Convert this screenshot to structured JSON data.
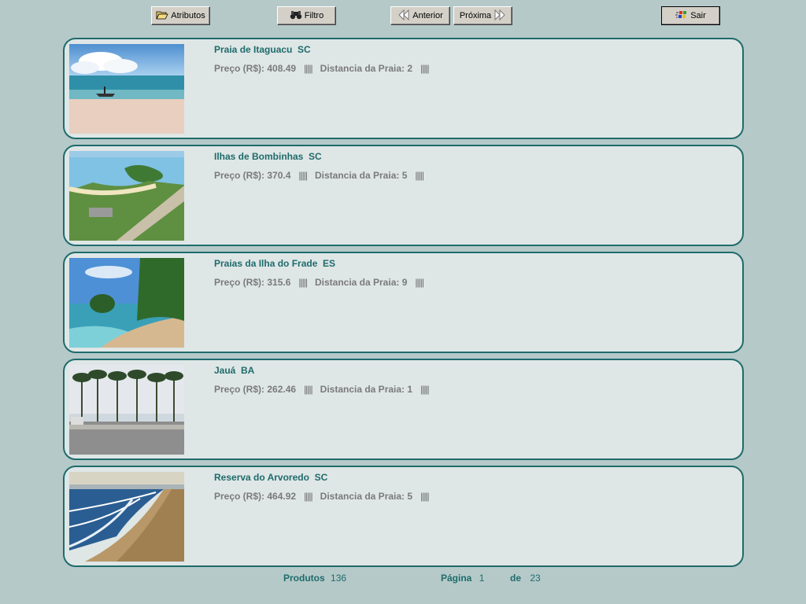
{
  "toolbar": {
    "atributos": "Atributos",
    "filtro": "Filtro",
    "anterior": "Anterior",
    "proxima": "Próxima",
    "sair": "Sair"
  },
  "listings": [
    {
      "title": "Praia de Itaguacu  SC",
      "preco_label": "Preço (R$):",
      "preco": "408.49",
      "bars": "|||||",
      "dist_label": "Distancia da Praia:",
      "dist": "2",
      "bars2": "|||||"
    },
    {
      "title": "Ilhas de Bombinhas  SC",
      "preco_label": "Preço (R$):",
      "preco": "370.4",
      "bars": "|||||",
      "dist_label": "Distancia da Praia:",
      "dist": "5",
      "bars2": "|||||"
    },
    {
      "title": "Praias da Ilha do Frade  ES",
      "preco_label": "Preço (R$):",
      "preco": "315.6",
      "bars": "|||||",
      "dist_label": "Distancia da Praia:",
      "dist": "9",
      "bars2": "|||||"
    },
    {
      "title": "Jauá  BA",
      "preco_label": "Preço (R$):",
      "preco": "262.46",
      "bars": "|||||",
      "dist_label": "Distancia da Praia:",
      "dist": "1",
      "bars2": "|||||"
    },
    {
      "title": "Reserva do Arvoredo  SC",
      "preco_label": "Preço (R$):",
      "preco": "464.92",
      "bars": "|||||",
      "dist_label": "Distancia da Praia:",
      "dist": "5",
      "bars2": "|||||"
    }
  ],
  "footer": {
    "produtos_label": "Produtos",
    "produtos": "136",
    "pagina_label": "Página",
    "pagina": "1",
    "de_label": "de",
    "total": "23"
  },
  "colors": {
    "background": "#b5c9c9",
    "card_border": "#1f6b6b",
    "accent_text": "#1f6b6b"
  }
}
